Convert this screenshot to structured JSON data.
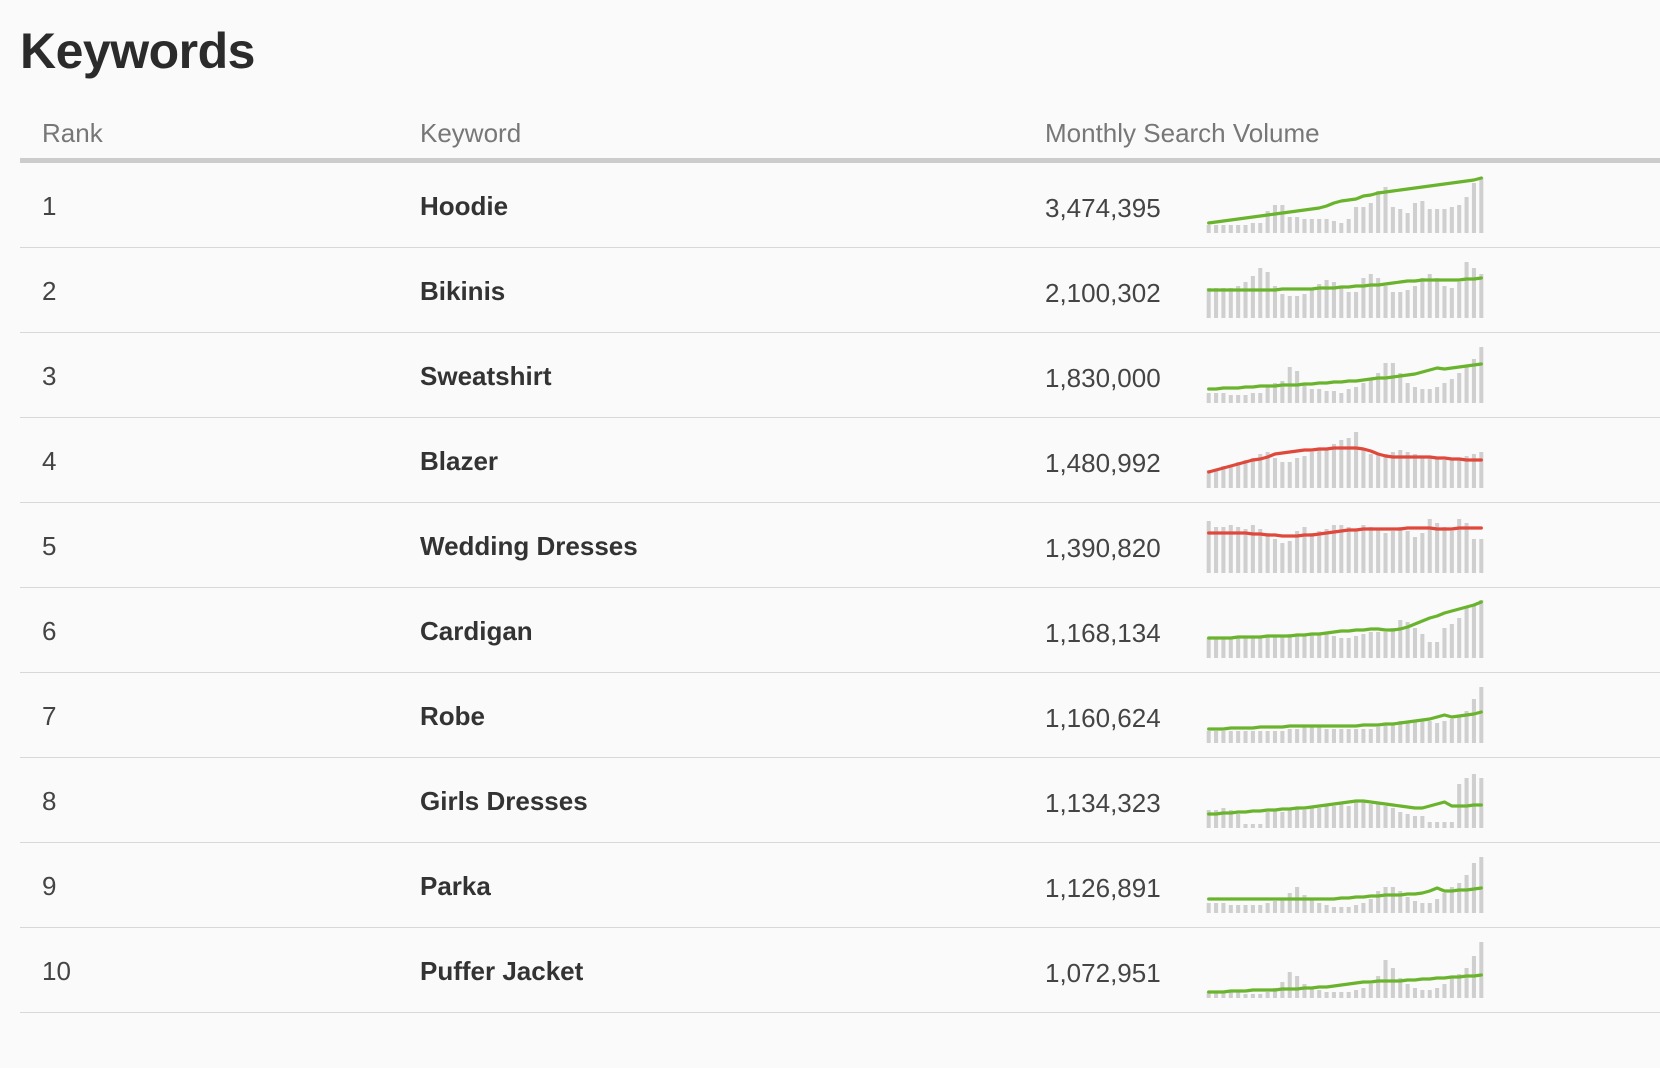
{
  "page": {
    "title": "Keywords"
  },
  "table": {
    "headers": {
      "rank": "Rank",
      "keyword": "Keyword",
      "volume": "Monthly Search Volume"
    },
    "colors": {
      "up": "#6ab42d",
      "down": "#e0483b",
      "bar": "#cfcfcf"
    },
    "rows": [
      {
        "rank": "1",
        "keyword": "Hoodie",
        "volume": "3,474,395",
        "trend": "up",
        "bars": [
          8,
          8,
          8,
          8,
          8,
          8,
          10,
          10,
          22,
          28,
          28,
          16,
          16,
          14,
          14,
          14,
          14,
          12,
          10,
          14,
          26,
          26,
          30,
          42,
          46,
          26,
          24,
          20,
          30,
          32,
          24,
          24,
          24,
          26,
          28,
          36,
          50,
          56
        ],
        "line": [
          10,
          11,
          12,
          13,
          14,
          15,
          16,
          17,
          18,
          19,
          20,
          21,
          22,
          23,
          24,
          25,
          27,
          30,
          32,
          33,
          34,
          37,
          38,
          40,
          41,
          42,
          43,
          44,
          45,
          46,
          47,
          48,
          49,
          50,
          51,
          52,
          53,
          55
        ]
      },
      {
        "rank": "2",
        "keyword": "Bikinis",
        "volume": "2,100,302",
        "trend": "up",
        "bars": [
          30,
          30,
          30,
          30,
          32,
          36,
          42,
          50,
          46,
          32,
          24,
          22,
          22,
          24,
          28,
          34,
          38,
          36,
          32,
          26,
          26,
          40,
          44,
          40,
          32,
          26,
          26,
          28,
          32,
          40,
          44,
          40,
          32,
          30,
          36,
          56,
          50,
          44
        ],
        "line": [
          28,
          28,
          28,
          28,
          28,
          28,
          28,
          28,
          28,
          28,
          29,
          29,
          29,
          29,
          29,
          30,
          30,
          30,
          31,
          31,
          32,
          32,
          33,
          33,
          34,
          35,
          36,
          37,
          37,
          38,
          38,
          38,
          38,
          38,
          38,
          39,
          39,
          40
        ]
      },
      {
        "rank": "3",
        "keyword": "Sweatshirt",
        "volume": "1,830,000",
        "trend": "up",
        "bars": [
          10,
          10,
          10,
          8,
          8,
          8,
          10,
          10,
          16,
          20,
          22,
          36,
          32,
          18,
          14,
          14,
          12,
          12,
          10,
          14,
          16,
          20,
          24,
          30,
          40,
          40,
          30,
          20,
          16,
          14,
          14,
          16,
          20,
          24,
          30,
          36,
          44,
          56
        ],
        "line": [
          14,
          14,
          15,
          15,
          15,
          16,
          16,
          17,
          17,
          17,
          18,
          18,
          18,
          19,
          19,
          20,
          20,
          21,
          21,
          22,
          22,
          23,
          24,
          25,
          25,
          26,
          27,
          28,
          29,
          31,
          33,
          35,
          34,
          35,
          36,
          37,
          38,
          39
        ]
      },
      {
        "rank": "4",
        "keyword": "Blazer",
        "volume": "1,480,992",
        "trend": "down",
        "bars": [
          18,
          18,
          22,
          22,
          26,
          28,
          30,
          34,
          36,
          30,
          26,
          26,
          30,
          32,
          36,
          40,
          38,
          44,
          48,
          50,
          56,
          38,
          34,
          34,
          34,
          36,
          38,
          36,
          34,
          32,
          30,
          30,
          28,
          28,
          30,
          32,
          34,
          36
        ],
        "line": [
          16,
          18,
          20,
          22,
          24,
          26,
          28,
          29,
          31,
          34,
          35,
          36,
          37,
          38,
          38,
          39,
          39,
          40,
          40,
          40,
          40,
          39,
          37,
          34,
          32,
          31,
          31,
          31,
          31,
          31,
          31,
          30,
          30,
          29,
          29,
          28,
          28,
          28
        ]
      },
      {
        "rank": "5",
        "keyword": "Wedding Dresses",
        "volume": "1,390,820",
        "trend": "down",
        "bars": [
          52,
          46,
          46,
          48,
          46,
          44,
          48,
          44,
          40,
          34,
          30,
          32,
          42,
          46,
          40,
          42,
          44,
          48,
          48,
          46,
          44,
          48,
          46,
          44,
          40,
          42,
          46,
          42,
          36,
          40,
          54,
          50,
          46,
          42,
          54,
          50,
          34,
          34
        ],
        "line": [
          40,
          40,
          40,
          40,
          40,
          40,
          39,
          39,
          38,
          38,
          37,
          37,
          37,
          38,
          38,
          39,
          40,
          41,
          42,
          43,
          43,
          44,
          44,
          44,
          44,
          44,
          44,
          45,
          45,
          45,
          45,
          44,
          44,
          44,
          45,
          45,
          45,
          45
        ]
      },
      {
        "rank": "6",
        "keyword": "Cardigan",
        "volume": "1,168,134",
        "trend": "up",
        "bars": [
          20,
          20,
          20,
          20,
          20,
          20,
          20,
          20,
          22,
          22,
          22,
          24,
          24,
          24,
          24,
          24,
          24,
          22,
          20,
          20,
          22,
          24,
          26,
          26,
          26,
          30,
          38,
          36,
          30,
          24,
          16,
          16,
          30,
          34,
          40,
          52,
          54,
          58
        ],
        "line": [
          20,
          20,
          20,
          20,
          21,
          21,
          21,
          21,
          22,
          22,
          22,
          22,
          23,
          23,
          24,
          24,
          25,
          26,
          27,
          27,
          28,
          28,
          29,
          29,
          28,
          28,
          29,
          31,
          34,
          37,
          40,
          42,
          45,
          47,
          49,
          51,
          53,
          56
        ]
      },
      {
        "rank": "7",
        "keyword": "Robe",
        "volume": "1,160,624",
        "trend": "up",
        "bars": [
          12,
          12,
          12,
          12,
          12,
          12,
          12,
          12,
          12,
          12,
          12,
          14,
          14,
          16,
          16,
          16,
          14,
          14,
          14,
          14,
          14,
          14,
          14,
          16,
          18,
          20,
          22,
          22,
          22,
          24,
          22,
          20,
          22,
          24,
          28,
          32,
          44,
          56
        ],
        "line": [
          14,
          14,
          14,
          15,
          15,
          15,
          15,
          16,
          16,
          16,
          16,
          17,
          17,
          17,
          17,
          17,
          17,
          17,
          17,
          17,
          17,
          18,
          18,
          18,
          19,
          19,
          20,
          21,
          22,
          23,
          24,
          26,
          28,
          26,
          27,
          28,
          29,
          31
        ]
      },
      {
        "rank": "8",
        "keyword": "Girls Dresses",
        "volume": "1,134,323",
        "trend": "up",
        "bars": [
          18,
          18,
          20,
          18,
          14,
          4,
          4,
          4,
          16,
          18,
          16,
          18,
          20,
          18,
          20,
          20,
          24,
          22,
          24,
          22,
          26,
          26,
          24,
          24,
          22,
          20,
          16,
          14,
          12,
          12,
          6,
          6,
          6,
          6,
          44,
          50,
          54,
          50
        ],
        "line": [
          14,
          14,
          15,
          15,
          16,
          16,
          17,
          17,
          18,
          18,
          19,
          19,
          20,
          20,
          21,
          22,
          23,
          24,
          25,
          26,
          27,
          27,
          26,
          25,
          24,
          23,
          22,
          21,
          20,
          20,
          22,
          24,
          26,
          22,
          22,
          22,
          23,
          23
        ]
      },
      {
        "rank": "9",
        "keyword": "Parka",
        "volume": "1,126,891",
        "trend": "up",
        "bars": [
          10,
          10,
          10,
          8,
          8,
          8,
          8,
          8,
          10,
          12,
          14,
          20,
          26,
          18,
          14,
          10,
          8,
          6,
          6,
          6,
          8,
          10,
          14,
          22,
          26,
          26,
          22,
          16,
          12,
          10,
          10,
          14,
          20,
          26,
          30,
          38,
          50,
          56
        ],
        "line": [
          14,
          14,
          14,
          14,
          14,
          14,
          14,
          14,
          14,
          14,
          14,
          14,
          14,
          14,
          14,
          14,
          14,
          14,
          15,
          15,
          16,
          16,
          17,
          17,
          18,
          18,
          18,
          19,
          19,
          20,
          22,
          25,
          22,
          22,
          23,
          23,
          24,
          25
        ]
      },
      {
        "rank": "10",
        "keyword": "Puffer Jacket",
        "volume": "1,072,951",
        "trend": "up",
        "bars": [
          6,
          6,
          6,
          6,
          6,
          4,
          4,
          4,
          6,
          10,
          16,
          26,
          22,
          14,
          10,
          8,
          6,
          6,
          6,
          6,
          8,
          10,
          14,
          22,
          38,
          30,
          20,
          14,
          10,
          8,
          8,
          10,
          14,
          20,
          24,
          30,
          42,
          56
        ],
        "line": [
          6,
          6,
          6,
          7,
          7,
          7,
          8,
          8,
          8,
          8,
          9,
          9,
          9,
          10,
          10,
          11,
          11,
          12,
          13,
          14,
          15,
          16,
          16,
          17,
          17,
          17,
          17,
          18,
          18,
          19,
          19,
          20,
          20,
          21,
          21,
          22,
          22,
          23
        ]
      }
    ]
  }
}
